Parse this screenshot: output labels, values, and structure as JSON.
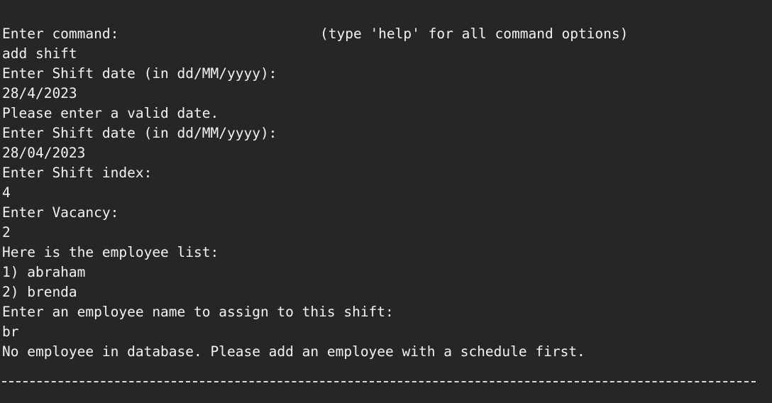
{
  "terminal": {
    "hint": "(type 'help' for all command options)",
    "lines": [
      "Enter command:",
      "add shift",
      "Enter Shift date (in dd/MM/yyyy):",
      "28/4/2023",
      "Please enter a valid date.",
      "Enter Shift date (in dd/MM/yyyy):",
      "28/04/2023",
      "Enter Shift index:",
      "4",
      "Enter Vacancy:",
      "2",
      "Here is the employee list:",
      "1) abraham",
      "2) brenda",
      "Enter an employee name to assign to this shift:",
      "br",
      "No employee in database. Please add an employee with a schedule first."
    ]
  },
  "colors": {
    "background": "#262626",
    "text": "#f2f2f2",
    "divider": "#d8d8d8"
  }
}
